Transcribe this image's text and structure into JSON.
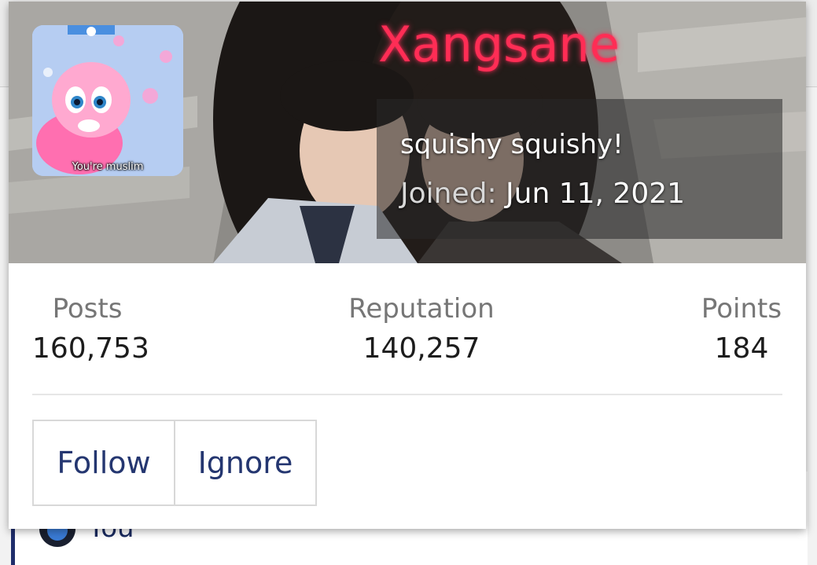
{
  "background_page": {
    "list_item_label": "You"
  },
  "profile_card": {
    "username": "Xangsane",
    "user_title": "squishy squishy!",
    "joined_label": "Joined:",
    "joined_date": "Jun 11, 2021",
    "avatar_caption": "You're muslim",
    "stats": [
      {
        "label": "Posts",
        "value": "160,753"
      },
      {
        "label": "Reputation",
        "value": "140,257"
      },
      {
        "label": "Points",
        "value": "184"
      }
    ],
    "actions": {
      "follow_label": "Follow",
      "ignore_label": "Ignore"
    }
  },
  "colors": {
    "username": "#ff2d55",
    "button_text": "#243670",
    "stat_label": "#767676",
    "stat_value": "#1c1c1c"
  }
}
